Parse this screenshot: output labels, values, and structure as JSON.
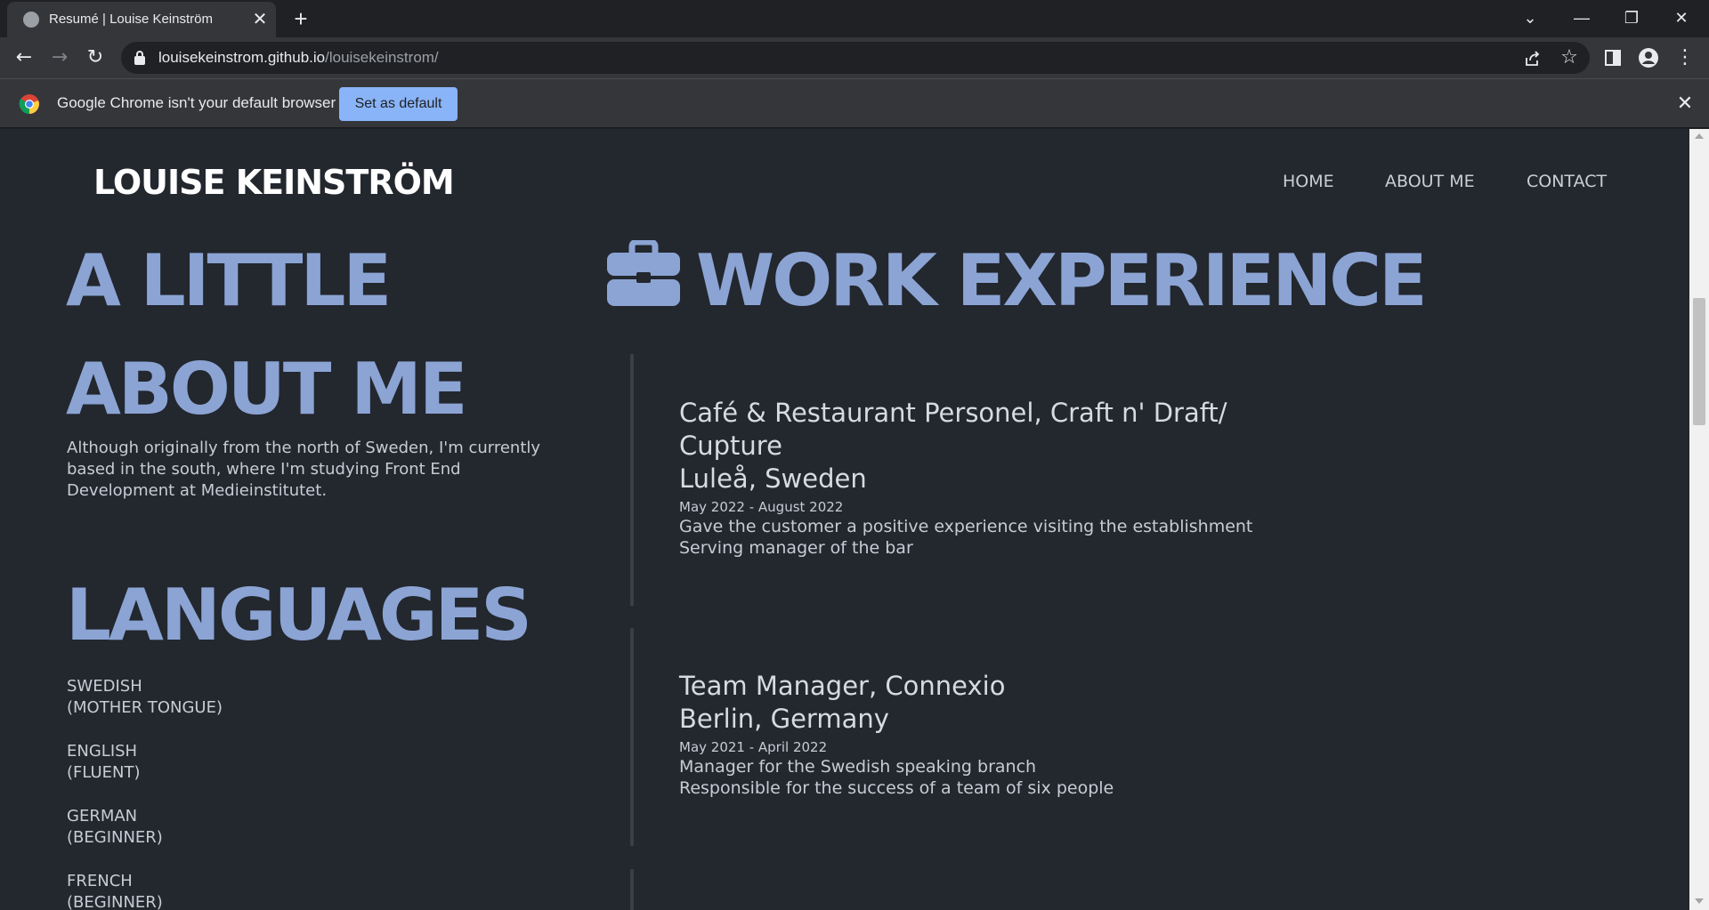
{
  "browser": {
    "tab_title": "Resumé | Louise Keinström",
    "new_tab_symbol": "+",
    "url_domain": "louisekeinstrom.github.io",
    "url_path": "/louisekeinstrom/",
    "infobar_message": "Google Chrome isn't your default browser",
    "infobar_button": "Set as default"
  },
  "site": {
    "brand": "LOUISE KEINSTRÖM",
    "nav": [
      "HOME",
      "ABOUT ME",
      "CONTACT"
    ]
  },
  "about": {
    "heading_line1": "A LITTLE",
    "heading_line2": "ABOUT ME",
    "text": "Although originally from the north of Sweden, I'm currently based in the south, where I'm studying Front End Development at Medieinstitutet."
  },
  "languages": {
    "heading": "LANGUAGES",
    "items": [
      {
        "name": "SWEDISH",
        "level": "(MOTHER TONGUE)"
      },
      {
        "name": "ENGLISH",
        "level": "(FLUENT)"
      },
      {
        "name": "GERMAN",
        "level": "(BEGINNER)"
      },
      {
        "name": "FRENCH",
        "level": "(BEGINNER)"
      }
    ]
  },
  "work": {
    "heading": "WORK EXPERIENCE",
    "icon": "briefcase-icon",
    "jobs": [
      {
        "title_line1": "Café & Restaurant Personel, Craft n' Draft/",
        "title_line2": "Cupture",
        "location": "Luleå, Sweden",
        "dates": "May 2022 - August 2022",
        "duties": [
          "Gave the customer a positive experience visiting the establishment",
          "Serving manager of the bar"
        ]
      },
      {
        "title_line1": "Team Manager, Connexio",
        "location": "Berlin, Germany",
        "dates": "May 2021 - April 2022",
        "duties": [
          "Manager for the Swedish speaking branch",
          "Responsible for the success of a team of six people"
        ]
      }
    ]
  },
  "colors": {
    "page_bg": "#23272e",
    "heading_accent": "#8ba4d4",
    "chrome_frame": "#202124",
    "chrome_toolbar": "#35363a",
    "infobar_button": "#8ab4f8"
  }
}
